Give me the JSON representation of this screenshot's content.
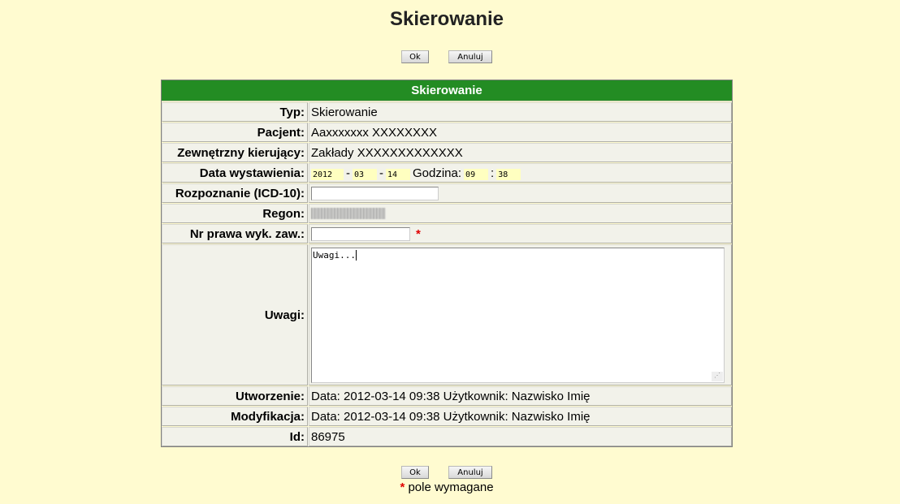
{
  "page": {
    "title": "Skierowanie"
  },
  "buttons": {
    "ok": "Ok",
    "cancel": "Anuluj"
  },
  "form": {
    "header": "Skierowanie",
    "fields": {
      "typ": {
        "label": "Typ:",
        "value": "Skierowanie"
      },
      "pacjent": {
        "label": "Pacjent:",
        "value": "Aaxxxxxxx XXXXXXXX"
      },
      "zewn": {
        "label": "Zewnętrzny kierujący:",
        "value": "Zakłady XXXXXXXXXXXXX"
      },
      "data": {
        "label": "Data wystawienia:",
        "year": "2012",
        "month": "03",
        "day": "14",
        "sep_dash": "-",
        "time_label": "Godzina:",
        "hour": "09",
        "minute": "38",
        "sep_colon": ":"
      },
      "icd": {
        "label": "Rozpoznanie (ICD-10):",
        "value": ""
      },
      "regon": {
        "label": "Regon:"
      },
      "nr_prawa": {
        "label": "Nr prawa wyk. zaw.:",
        "value": "",
        "required_mark": "*"
      },
      "uwagi": {
        "label": "Uwagi:",
        "value": "Uwagi..."
      },
      "utworzenie": {
        "label": "Utworzenie:",
        "value": "Data: 2012-03-14 09:38 Użytkownik: Nazwisko Imię"
      },
      "modyfikacja": {
        "label": "Modyfikacja:",
        "value": "Data: 2012-03-14 09:38 Użytkownik: Nazwisko Imię"
      },
      "id": {
        "label": "Id:",
        "value": "86975"
      }
    }
  },
  "footer": {
    "required_star": "*",
    "required_text": "pole wymagane"
  },
  "colors": {
    "background": "#fffbd0",
    "header_green": "#238c23",
    "required_red": "#e00000",
    "date_field_bg": "#ffffc0"
  }
}
